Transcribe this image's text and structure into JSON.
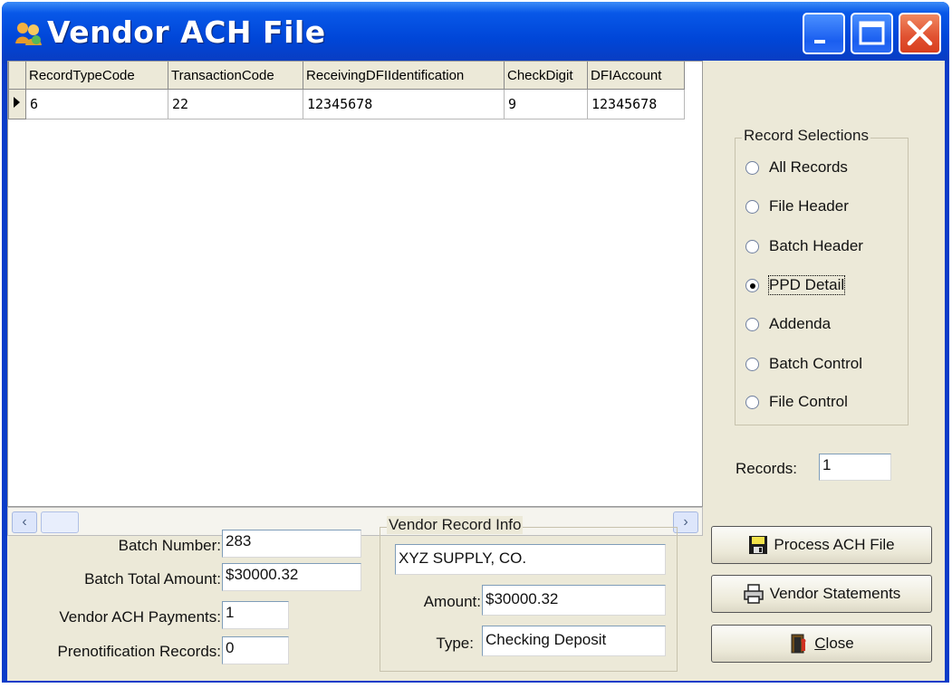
{
  "window": {
    "title": "Vendor ACH File"
  },
  "grid": {
    "columns": [
      "RecordTypeCode",
      "TransactionCode",
      "ReceivingDFIIdentification",
      "CheckDigit",
      "DFIAccount"
    ],
    "rows": [
      [
        "6",
        "22",
        "12345678",
        "9",
        "12345678"
      ]
    ]
  },
  "record_selections": {
    "title": "Record Selections",
    "options": [
      "All Records",
      "File Header",
      "Batch Header",
      "PPD Detail",
      "Addenda",
      "Batch Control",
      "File Control"
    ],
    "selected": "PPD Detail"
  },
  "records": {
    "label": "Records:",
    "value": "1"
  },
  "batch": {
    "number_label": "Batch Number:",
    "number": "283",
    "total_label": "Batch Total Amount:",
    "total": "$30000.32",
    "payments_label": "Vendor ACH Payments:",
    "payments": "1",
    "prenote_label": "Prenotification Records:",
    "prenote": "0"
  },
  "vendor_info": {
    "title": "Vendor Record Info",
    "name": "XYZ SUPPLY, CO.",
    "amount_label": "Amount:",
    "amount": "$30000.32",
    "type_label": "Type:",
    "type": "Checking Deposit"
  },
  "buttons": {
    "process": "Process ACH File",
    "statements": "Vendor Statements",
    "close_prefix": "",
    "close_accel": "C",
    "close_rest": "lose"
  },
  "colors": {
    "titlebar": "#0054e3",
    "face": "#ece9d8",
    "close_button": "#e05030"
  }
}
